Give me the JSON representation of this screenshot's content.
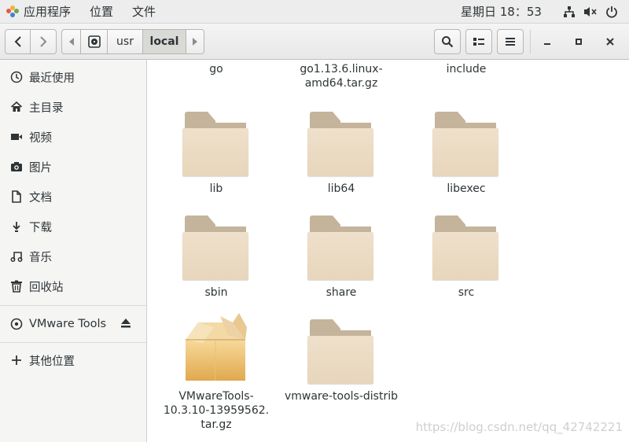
{
  "topbar": {
    "menus": [
      "应用程序",
      "位置",
      "文件"
    ],
    "clock": "星期日 18：53"
  },
  "header": {
    "path": [
      "usr",
      "local"
    ]
  },
  "sidebar": {
    "items": [
      {
        "label": "最近使用",
        "icon": "recent-icon"
      },
      {
        "label": "主目录",
        "icon": "home-icon"
      },
      {
        "label": "视频",
        "icon": "video-icon"
      },
      {
        "label": "图片",
        "icon": "camera-icon"
      },
      {
        "label": "文档",
        "icon": "document-icon"
      },
      {
        "label": "下载",
        "icon": "download-icon"
      },
      {
        "label": "音乐",
        "icon": "music-icon"
      },
      {
        "label": "回收站",
        "icon": "trash-icon"
      }
    ],
    "device": {
      "label": "VMware Tools",
      "icon": "disc-icon"
    },
    "other": {
      "label": "其他位置",
      "icon": "plus-icon"
    }
  },
  "files": {
    "row0": [
      {
        "name_lines": [
          "go"
        ]
      },
      {
        "name_lines": [
          "go1.13.6.linux-",
          "amd64.tar.gz"
        ]
      },
      {
        "name_lines": [
          "include"
        ]
      }
    ],
    "items": [
      {
        "name_lines": [
          "lib"
        ],
        "type": "folder"
      },
      {
        "name_lines": [
          "lib64"
        ],
        "type": "folder"
      },
      {
        "name_lines": [
          "libexec"
        ],
        "type": "folder"
      },
      {
        "name_lines": [
          "sbin"
        ],
        "type": "folder"
      },
      {
        "name_lines": [
          "share"
        ],
        "type": "folder"
      },
      {
        "name_lines": [
          "src"
        ],
        "type": "folder"
      },
      {
        "name_lines": [
          "VMwareTools-",
          "10.3.10-13959562.",
          "tar.gz"
        ],
        "type": "archive"
      },
      {
        "name_lines": [
          "vmware-tools-distrib"
        ],
        "type": "folder"
      }
    ]
  },
  "watermark": "https://blog.csdn.net/qq_42742221",
  "colors": {
    "folder_tab": "#c4b49b",
    "folder_body": "#ebdcc4",
    "sidebar_bg": "#f5f5f4"
  }
}
